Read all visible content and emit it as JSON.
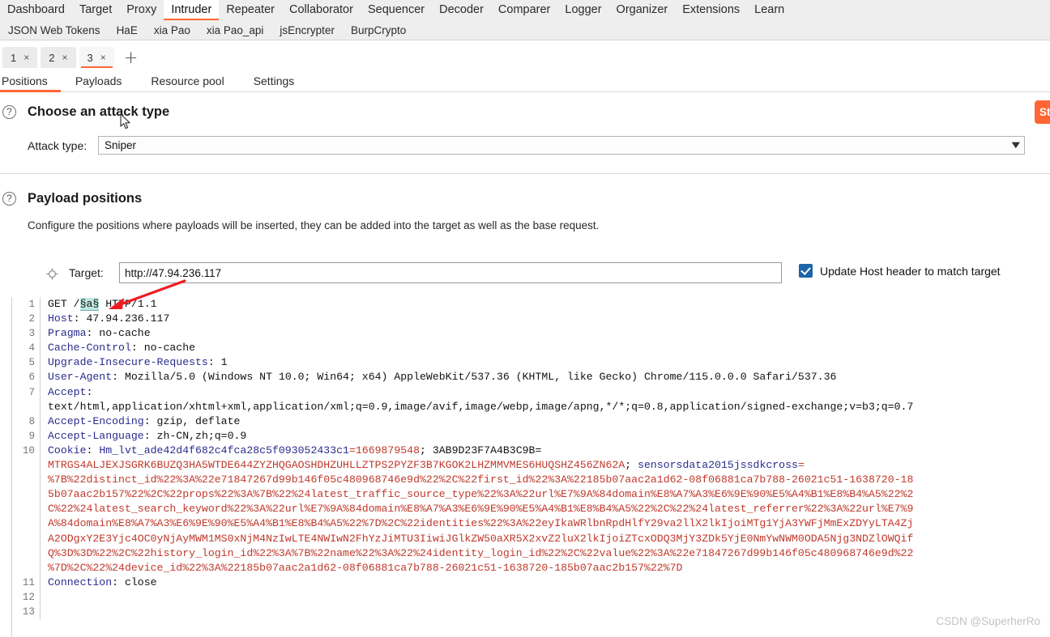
{
  "colors": {
    "accent": "#ff6633",
    "checkbox": "#1d64a8",
    "header_key": "#2b2b8f",
    "cookie_value": "#c0392b",
    "marker_highlight": "#bde8e0",
    "tabbar_bg": "#eeeeee"
  },
  "main_tabs": [
    {
      "label": "Dashboard",
      "selected": false
    },
    {
      "label": "Target",
      "selected": false
    },
    {
      "label": "Proxy",
      "selected": false
    },
    {
      "label": "Intruder",
      "selected": true
    },
    {
      "label": "Repeater",
      "selected": false
    },
    {
      "label": "Collaborator",
      "selected": false
    },
    {
      "label": "Sequencer",
      "selected": false
    },
    {
      "label": "Decoder",
      "selected": false
    },
    {
      "label": "Comparer",
      "selected": false
    },
    {
      "label": "Logger",
      "selected": false
    },
    {
      "label": "Organizer",
      "selected": false
    },
    {
      "label": "Extensions",
      "selected": false
    },
    {
      "label": "Learn",
      "selected": false
    }
  ],
  "extension_tabs": [
    {
      "label": "JSON Web Tokens"
    },
    {
      "label": "HaE"
    },
    {
      "label": "xia Pao"
    },
    {
      "label": "xia Pao_api"
    },
    {
      "label": "jsEncrypter"
    },
    {
      "label": "BurpCrypto"
    }
  ],
  "attack_tabs": [
    {
      "label": "1",
      "close": "×",
      "selected": false
    },
    {
      "label": "2",
      "close": "×",
      "selected": false
    },
    {
      "label": "3",
      "close": "×",
      "selected": true
    }
  ],
  "attack_tab_add": "+",
  "sub_tabs": [
    {
      "label": "Positions",
      "selected": true
    },
    {
      "label": "Payloads",
      "selected": false
    },
    {
      "label": "Resource pool",
      "selected": false
    },
    {
      "label": "Settings",
      "selected": false
    }
  ],
  "attack_section": {
    "help_icon": "?",
    "heading": "Choose an attack type",
    "field_label": "Attack type:",
    "attack_type_value": "Sniper",
    "chevron": "▼",
    "start_attack_label": "Start attack"
  },
  "positions_section": {
    "help_icon": "?",
    "heading": "Payload positions",
    "description": "Configure the positions where payloads will be inserted, they can be added into the target as well as the base request.",
    "target_icon": "crosshair-icon",
    "target_label": "Target:",
    "target_value": "http://47.94.236.117",
    "update_host_label": "Update Host header to match target",
    "update_host_checked": true
  },
  "request": {
    "lines": [
      {
        "num": "1",
        "tokens": [
          {
            "t": "GET /",
            "c": "plain"
          },
          {
            "t": "§a§",
            "c": "mark"
          },
          {
            "t": " HTTP/1.1",
            "c": "plain"
          }
        ]
      },
      {
        "num": "2",
        "tokens": [
          {
            "t": "Host",
            "c": "key"
          },
          {
            "t": ": 47.94.236.117",
            "c": "plain"
          }
        ]
      },
      {
        "num": "3",
        "tokens": [
          {
            "t": "Pragma",
            "c": "key"
          },
          {
            "t": ": no-cache",
            "c": "plain"
          }
        ]
      },
      {
        "num": "4",
        "tokens": [
          {
            "t": "Cache-Control",
            "c": "key"
          },
          {
            "t": ": no-cache",
            "c": "plain"
          }
        ]
      },
      {
        "num": "5",
        "tokens": [
          {
            "t": "Upgrade-Insecure-Requests",
            "c": "key"
          },
          {
            "t": ": 1",
            "c": "plain"
          }
        ]
      },
      {
        "num": "6",
        "tokens": [
          {
            "t": "User-Agent",
            "c": "key"
          },
          {
            "t": ": Mozilla/5.0 (Windows NT 10.0; Win64; x64) AppleWebKit/537.36 (KHTML, like Gecko) Chrome/115.0.0.0 Safari/537.36",
            "c": "plain"
          }
        ]
      },
      {
        "num": "7",
        "tokens": [
          {
            "t": "Accept",
            "c": "key"
          },
          {
            "t": ":",
            "c": "plain"
          }
        ]
      },
      {
        "num": "",
        "tokens": [
          {
            "t": "text/html,application/xhtml+xml,application/xml;q=0.9,image/avif,image/webp,image/apng,*/*;q=0.8,application/signed-exchange;v=b3;q=0.7",
            "c": "plain"
          }
        ]
      },
      {
        "num": "8",
        "tokens": [
          {
            "t": "Accept-Encoding",
            "c": "key"
          },
          {
            "t": ": gzip, deflate",
            "c": "plain"
          }
        ]
      },
      {
        "num": "9",
        "tokens": [
          {
            "t": "Accept-Language",
            "c": "key"
          },
          {
            "t": ": zh-CN,zh;q=0.9",
            "c": "plain"
          }
        ]
      },
      {
        "num": "10",
        "tokens": [
          {
            "t": "Cookie",
            "c": "key"
          },
          {
            "t": ": ",
            "c": "plain"
          },
          {
            "t": "Hm_lvt_ade42d4f682c4fca28c5f093052433c1",
            "c": "key"
          },
          {
            "t": "=1669879548",
            "c": "val"
          },
          {
            "t": "; ",
            "c": "plain"
          },
          {
            "t": "3AB9D23F7A4B3C9B",
            "c": "plain"
          },
          {
            "t": "=",
            "c": "plain"
          }
        ]
      },
      {
        "num": "",
        "tokens": [
          {
            "t": "MTRGS4ALJEXJSGRK6BUZQ3HA5WTDE644ZYZHQGAOSHDHZUHLLZTPS2PYZF3B7KGOK2LHZMMVMES6HUQSHZ456ZN62A",
            "c": "val"
          },
          {
            "t": "; ",
            "c": "plain"
          },
          {
            "t": "sensorsdata2015jssdkcross",
            "c": "key"
          },
          {
            "t": "=",
            "c": "val"
          }
        ]
      },
      {
        "num": "",
        "tokens": [
          {
            "t": "%7B%22distinct_id%22%3A%22e71847267d99b146f05c480968746e9d%22%2C%22first_id%22%3A%22185b07aac2a1d62-08f06881ca7b788-26021c51-1638720-18",
            "c": "val"
          }
        ]
      },
      {
        "num": "",
        "tokens": [
          {
            "t": "5b07aac2b157%22%2C%22props%22%3A%7B%22%24latest_traffic_source_type%22%3A%22url%E7%9A%84domain%E8%A7%A3%E6%9E%90%E5%A4%B1%E8%B4%A5%22%2",
            "c": "val"
          }
        ]
      },
      {
        "num": "",
        "tokens": [
          {
            "t": "C%22%24latest_search_keyword%22%3A%22url%E7%9A%84domain%E8%A7%A3%E6%9E%90%E5%A4%B1%E8%B4%A5%22%2C%22%24latest_referrer%22%3A%22url%E7%9",
            "c": "val"
          }
        ]
      },
      {
        "num": "",
        "tokens": [
          {
            "t": "A%84domain%E8%A7%A3%E6%9E%90%E5%A4%B1%E8%B4%A5%22%7D%2C%22identities%22%3A%22eyIkaWRlbnRpdHlfY29va2llX2lkIjoiMTg1YjA3YWFjMmExZDYyLTA4Zj",
            "c": "val"
          }
        ]
      },
      {
        "num": "",
        "tokens": [
          {
            "t": "A2ODgxY2E3Yjc4OC0yNjAyMWM1MS0xNjM4NzIwLTE4NWIwN2FhYzJiMTU3IiwiJGlkZW50aXR5X2xvZ2luX2lkIjoiZTcxODQ3MjY3ZDk5YjE0NmYwNWM0ODA5Njg3NDZlOWQif",
            "c": "val"
          }
        ]
      },
      {
        "num": "",
        "tokens": [
          {
            "t": "Q%3D%3D%22%2C%22history_login_id%22%3A%7B%22name%22%3A%22%24identity_login_id%22%2C%22value%22%3A%22e71847267d99b146f05c480968746e9d%22",
            "c": "val"
          }
        ]
      },
      {
        "num": "",
        "tokens": [
          {
            "t": "%7D%2C%22%24device_id%22%3A%22185b07aac2a1d62-08f06881ca7b788-26021c51-1638720-185b07aac2b157%22%7D",
            "c": "val"
          }
        ]
      },
      {
        "num": "11",
        "tokens": [
          {
            "t": "Connection",
            "c": "key"
          },
          {
            "t": ": close",
            "c": "plain"
          }
        ]
      },
      {
        "num": "12",
        "tokens": []
      },
      {
        "num": "13",
        "tokens": []
      }
    ]
  },
  "watermark": "CSDN @SuperherRo"
}
